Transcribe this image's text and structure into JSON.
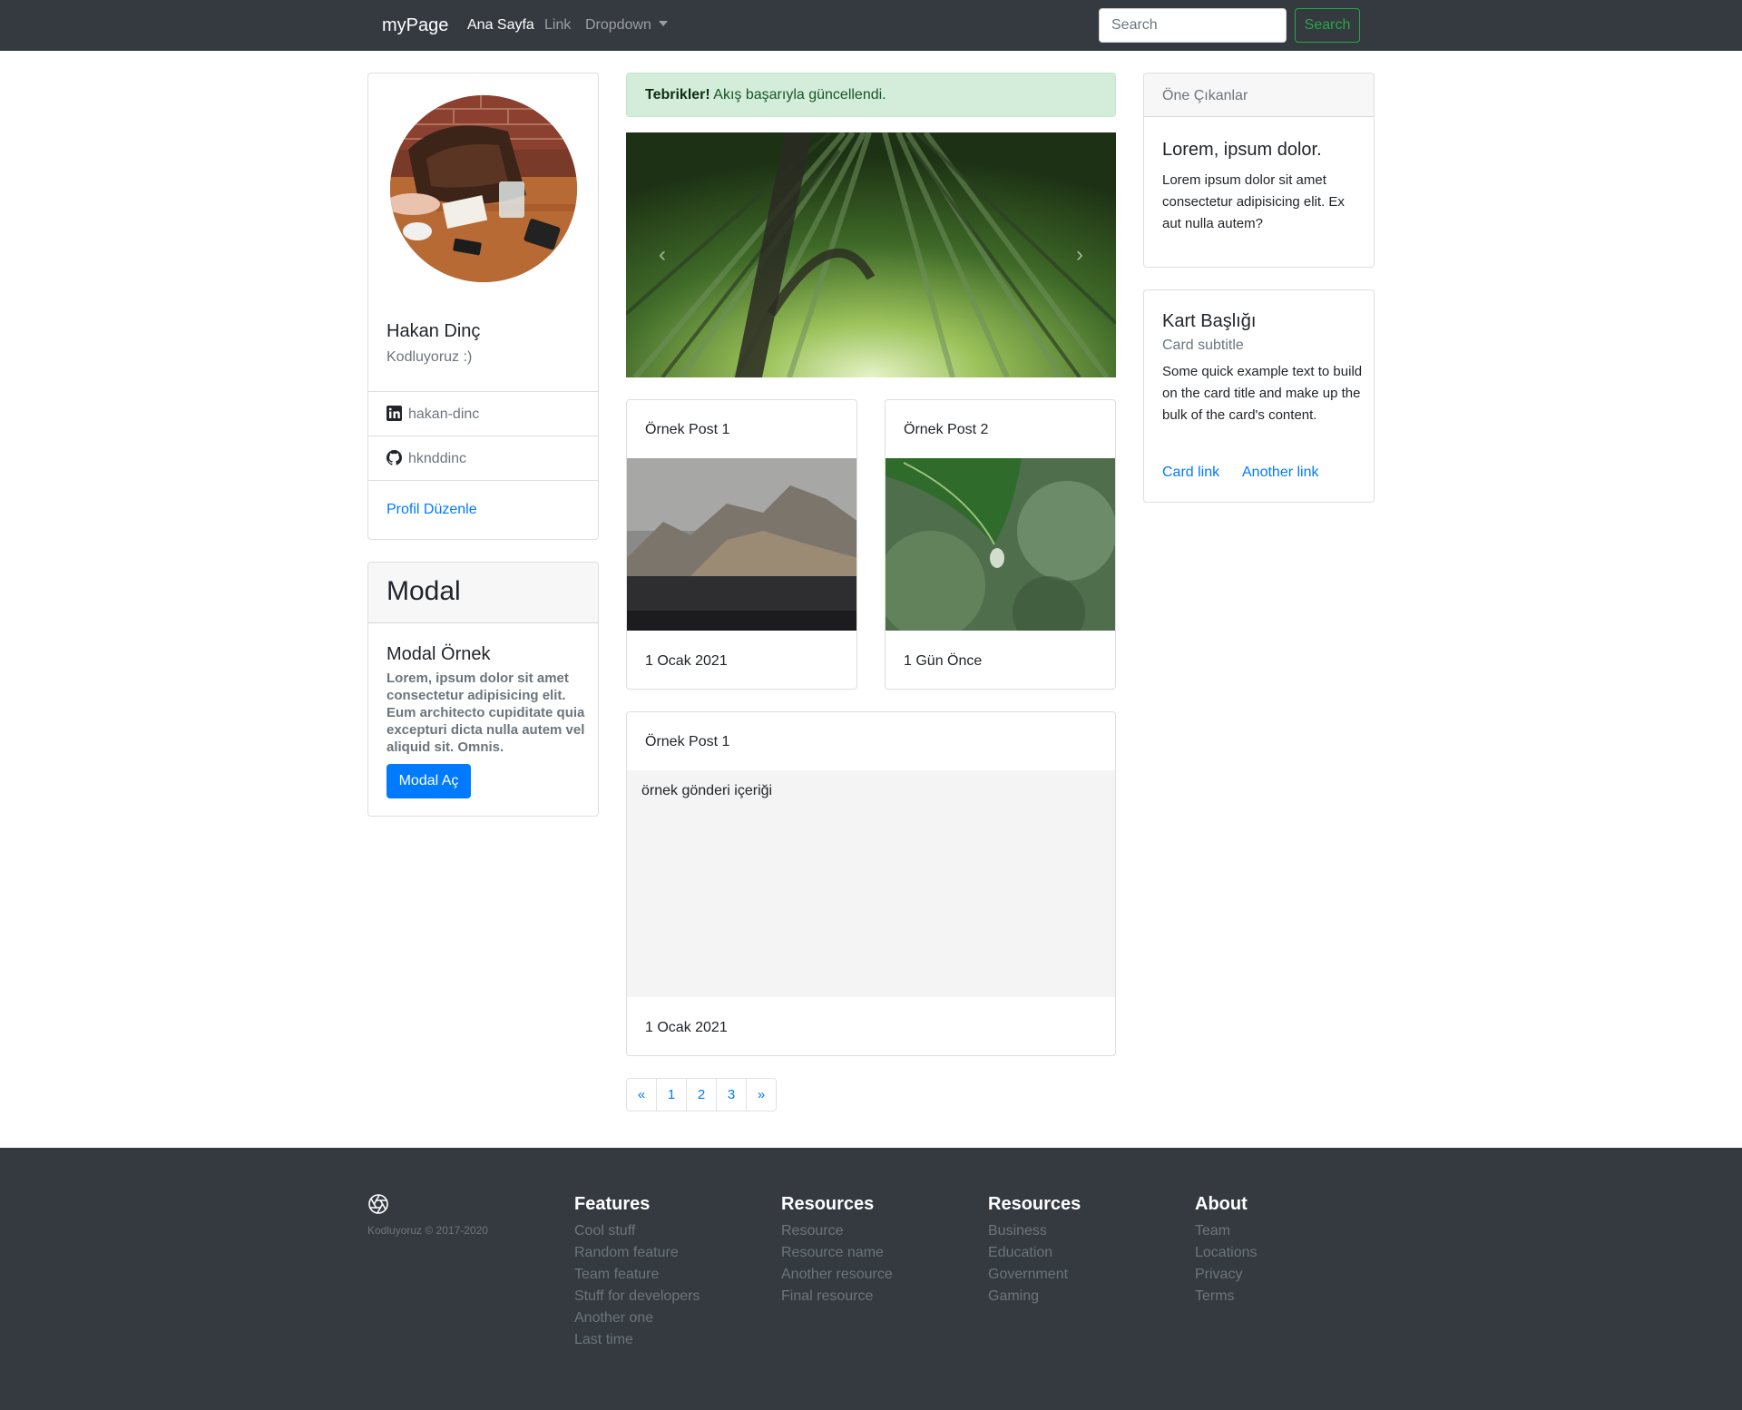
{
  "navbar": {
    "brand": "myPage",
    "links": [
      "Ana Sayfa",
      "Link",
      "Dropdown"
    ],
    "search_placeholder": "Search",
    "search_button": "Search"
  },
  "profile": {
    "name": "Hakan Dinç",
    "subtitle": "Kodluyoruz :)",
    "linkedin": "hakan-dinc",
    "github": "hknddinc",
    "edit_link": "Profil Düzenle"
  },
  "modal_card": {
    "header": "Modal",
    "title": "Modal Örnek",
    "text": "Lorem, ipsum dolor sit amet consectetur adipisicing elit. Eum architecto cupiditate quia excepturi dicta nulla autem vel aliquid sit. Omnis.",
    "button": "Modal Aç"
  },
  "alert": {
    "strong": "Tebrikler!",
    "text": "Akış başarıyla güncellendi."
  },
  "posts": [
    {
      "title": "Örnek Post 1",
      "footer": "1 Ocak 2021"
    },
    {
      "title": "Örnek Post 2",
      "footer": "1 Gün Önce"
    }
  ],
  "post_wide": {
    "title": "Örnek Post 1",
    "body": "örnek gönderi içeriği",
    "footer": "1 Ocak 2021"
  },
  "pagination": [
    "«",
    "1",
    "2",
    "3",
    "»"
  ],
  "featured": {
    "header": "Öne Çıkanlar",
    "title": "Lorem, ipsum dolor.",
    "text": "Lorem ipsum dolor sit amet consectetur adipisicing elit. Ex aut nulla autem?"
  },
  "kart": {
    "title": "Kart Başlığı",
    "subtitle": "Card subtitle",
    "text": "Some quick example text to build on the card title and make up the bulk of the card's content.",
    "link1": "Card link",
    "link2": "Another link"
  },
  "footer": {
    "copyright": "Kodluyoruz © 2017-2020",
    "columns": [
      {
        "title": "Features",
        "items": [
          "Cool stuff",
          "Random feature",
          "Team feature",
          "Stuff for developers",
          "Another one",
          "Last time"
        ]
      },
      {
        "title": "Resources",
        "items": [
          "Resource",
          "Resource name",
          "Another resource",
          "Final resource"
        ]
      },
      {
        "title": "Resources",
        "items": [
          "Business",
          "Education",
          "Government",
          "Gaming"
        ]
      },
      {
        "title": "About",
        "items": [
          "Team",
          "Locations",
          "Privacy",
          "Terms"
        ]
      }
    ]
  },
  "colors": {
    "navbar_bg": "#343a40",
    "primary": "#007bff",
    "success": "#28a745",
    "alert_bg": "#d4edda"
  },
  "icons": [
    "linkedin-icon",
    "github-icon",
    "aperture-logo-icon",
    "chevron-left-icon",
    "chevron-right-icon",
    "caret-down-icon"
  ]
}
